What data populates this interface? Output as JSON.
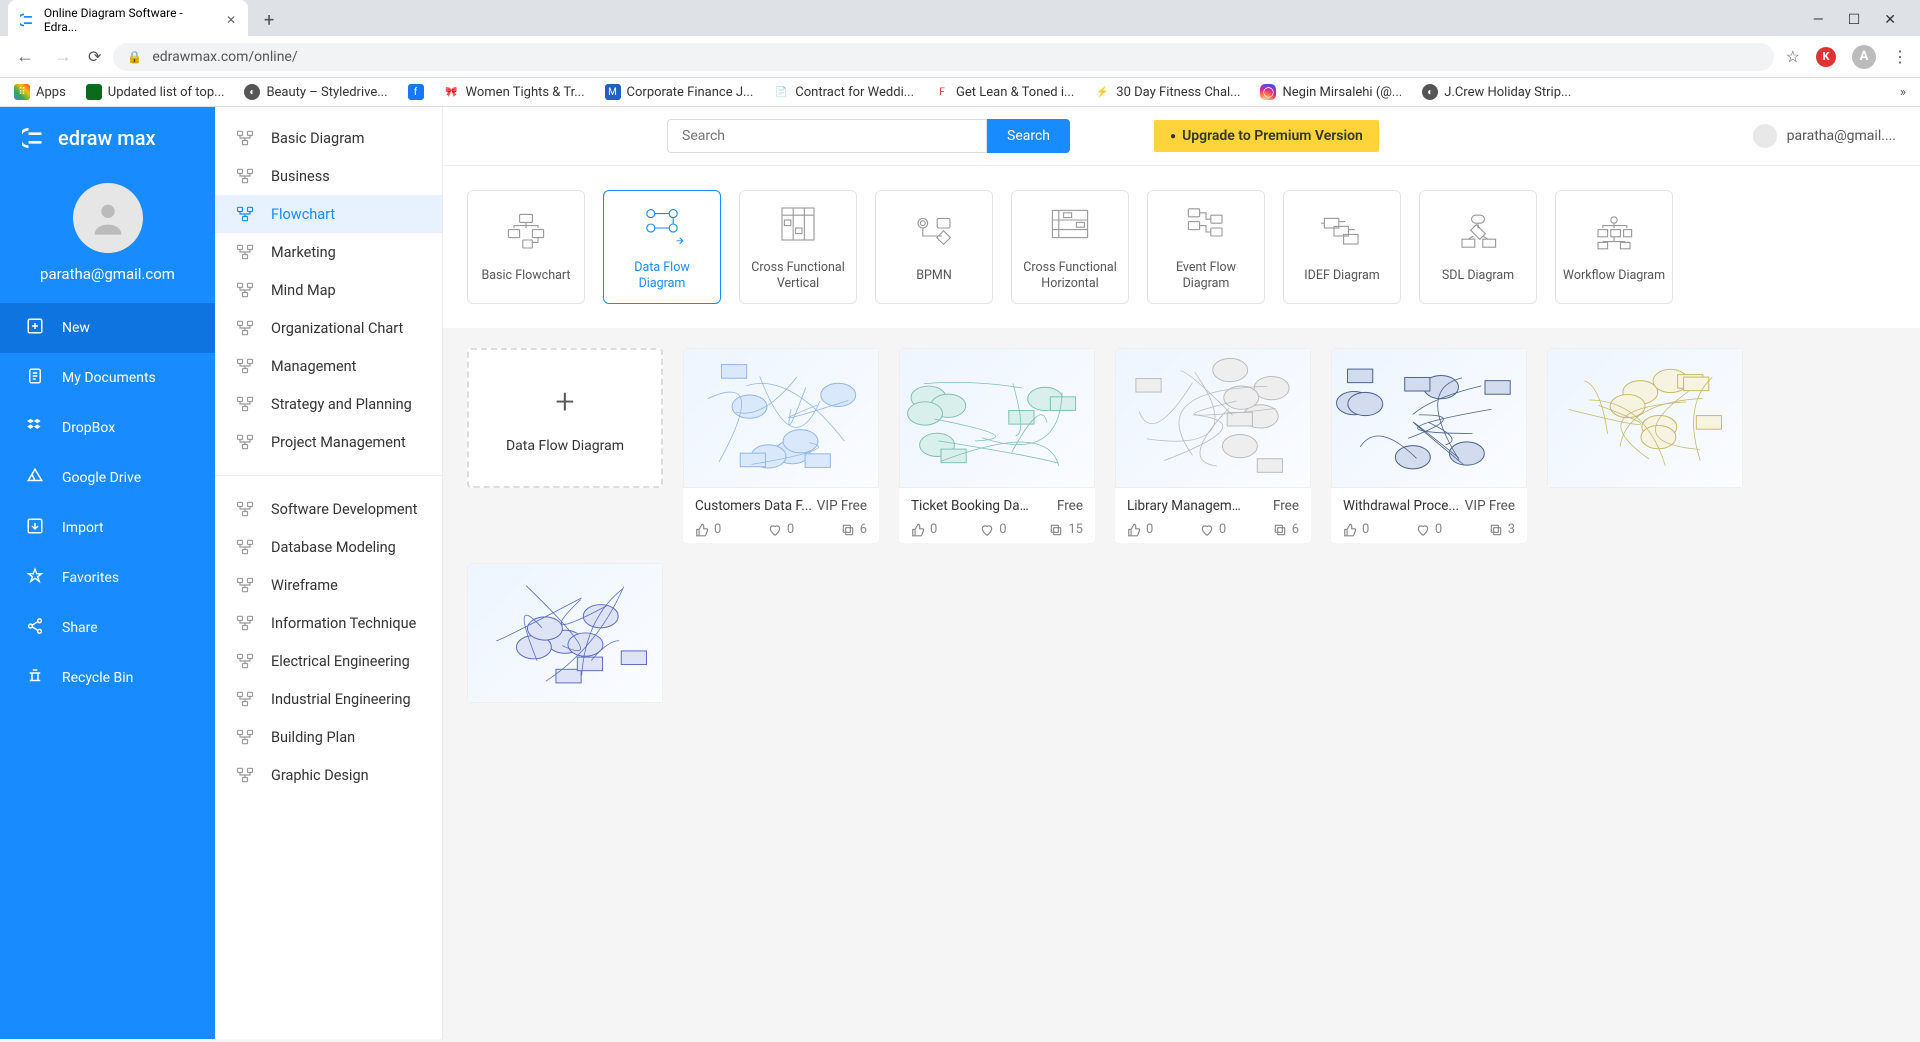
{
  "browser": {
    "tab_title": "Online Diagram Software - Edra...",
    "url": "edrawmax.com/online/",
    "avatar_k": "K",
    "avatar_a": "A",
    "bookmarks": [
      "Apps",
      "Updated list of top...",
      "Beauty – Styledrive...",
      "",
      "Women Tights & Tr...",
      "Corporate Finance J...",
      "Contract for Weddi...",
      "Get Lean & Toned i...",
      "30 Day Fitness Chal...",
      "Negin Mirsalehi (@...",
      "J.Crew Holiday Strip..."
    ]
  },
  "app": {
    "logo": "edraw max",
    "user_email": "paratha@gmail.com",
    "primary_nav": [
      {
        "label": "New",
        "icon": "plus"
      },
      {
        "label": "My Documents",
        "icon": "doc"
      },
      {
        "label": "DropBox",
        "icon": "dropbox"
      },
      {
        "label": "Google Drive",
        "icon": "gdrive"
      },
      {
        "label": "Import",
        "icon": "import"
      },
      {
        "label": "Favorites",
        "icon": "star"
      },
      {
        "label": "Share",
        "icon": "share"
      },
      {
        "label": "Recycle Bin",
        "icon": "trash"
      }
    ],
    "secondary_nav_a": [
      "Basic Diagram",
      "Business",
      "Flowchart",
      "Marketing",
      "Mind Map",
      "Organizational Chart",
      "Management",
      "Strategy and Planning",
      "Project Management"
    ],
    "secondary_nav_b": [
      "Software Development",
      "Database Modeling",
      "Wireframe",
      "Information Technique",
      "Electrical Engineering",
      "Industrial Engineering",
      "Building Plan",
      "Graphic Design"
    ],
    "secondary_active": "Flowchart",
    "search_placeholder": "Search",
    "search_btn": "Search",
    "upgrade": "Upgrade to Premium Version",
    "account_email": "paratha@gmail....",
    "diagram_types": [
      "Basic Flowchart",
      "Data Flow Diagram",
      "Cross Functional Vertical",
      "BPMN",
      "Cross Functional Horizontal",
      "Event Flow Diagram",
      "IDEF Diagram",
      "SDL Diagram",
      "Workflow Diagram"
    ],
    "diagram_active": "Data Flow Diagram",
    "new_card_label": "Data Flow Diagram",
    "templates": [
      {
        "name": "Customers Data F...",
        "price": "VIP Free",
        "likes": 0,
        "favs": 0,
        "copies": 6,
        "theme": "blue"
      },
      {
        "name": "Ticket Booking Data F...",
        "price": "Free",
        "likes": 0,
        "favs": 0,
        "copies": 15,
        "theme": "teal"
      },
      {
        "name": "Library Management ...",
        "price": "Free",
        "likes": 0,
        "favs": 0,
        "copies": 6,
        "theme": "gray"
      },
      {
        "name": "Withdrawal Proce...",
        "price": "VIP Free",
        "likes": 0,
        "favs": 0,
        "copies": 3,
        "theme": "navy"
      }
    ]
  }
}
